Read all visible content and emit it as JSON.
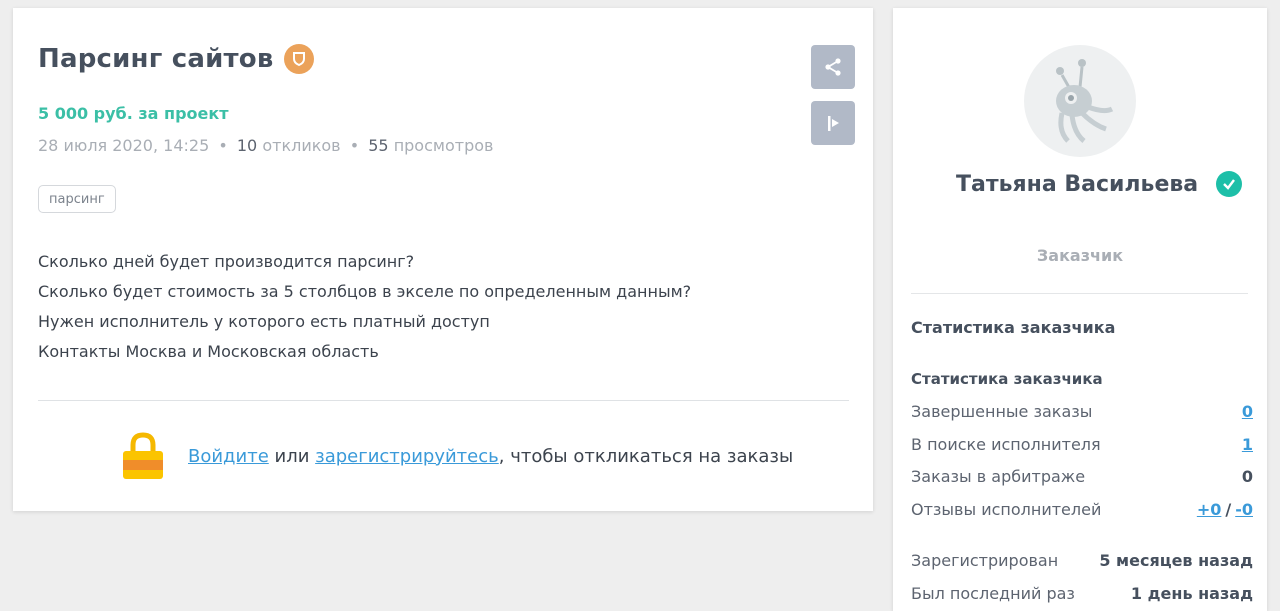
{
  "project": {
    "title": "Парсинг сайтов",
    "price": "5 000 руб. за проект",
    "date": "28 июля 2020, 14:25",
    "responses_count": "10",
    "responses_label": "откликов",
    "views_count": "55",
    "views_label": "просмотров",
    "separator": "•",
    "tag": "парсинг",
    "description": [
      "Сколько дней будет производится парсинг?",
      "Сколько будет стоимость за 5 столбцов в экселе по определенным данным?",
      "Нужен исполнитель у которого есть платный доступ",
      "Контакты Москва и Московская область"
    ],
    "login": {
      "login_link": "Войдите",
      "or": "или",
      "register_link": "зарегистрируйтесь",
      "suffix": ", чтобы откликаться на заказы"
    }
  },
  "customer": {
    "name": "Татьяна Васильева",
    "role": "Заказчик",
    "stats_title": "Статистика заказчика",
    "stats_subtitle": "Статистика заказчика",
    "stats": [
      {
        "label": "Завершенные заказы",
        "value": "0"
      },
      {
        "label": "В поиске исполнителя",
        "value": "1"
      },
      {
        "label": "Заказы в арбитраже",
        "value": "0"
      }
    ],
    "reviews": {
      "label": "Отзывы исполнителей",
      "positive": "+0",
      "slash": "/",
      "negative": "-0"
    },
    "registered": {
      "label": "Зарегистрирован",
      "value": "5 месяцев назад"
    },
    "last_seen": {
      "label": "Был последний раз",
      "value": "1 день назад"
    }
  },
  "colors": {
    "accent_green": "#3bbfa6",
    "link_blue": "#3a9ad9",
    "shield_orange": "#eba25a",
    "verified_teal": "#1dbfa8",
    "button_gray": "#b1b9c7"
  },
  "icons": [
    "shield-icon",
    "share-icon",
    "report-icon",
    "lock-icon",
    "verified-check-icon",
    "avatar-robot-icon"
  ]
}
